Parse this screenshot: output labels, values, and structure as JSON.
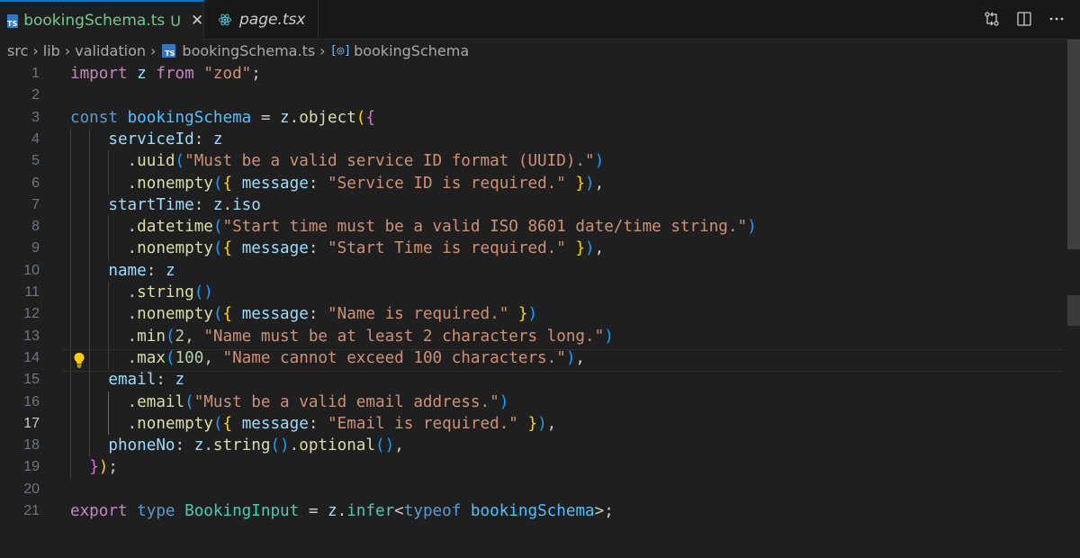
{
  "tabs": [
    {
      "label": "bookingSchema.ts",
      "badge": "U",
      "icon": "typescript-icon",
      "close": "✕",
      "active": true
    },
    {
      "label": "page.tsx",
      "icon": "react-icon",
      "active": false
    }
  ],
  "breadcrumb": {
    "items": [
      "src",
      "lib",
      "validation",
      "bookingSchema.ts",
      "bookingSchema"
    ],
    "separator": "›"
  },
  "ts_icon_text": "TS",
  "editor": {
    "current_line": 17,
    "lines": [
      {
        "n": "1",
        "tokens": [
          [
            "kw",
            "import"
          ],
          [
            "p",
            " "
          ],
          [
            "id",
            "z"
          ],
          [
            "p",
            " "
          ],
          [
            "kw",
            "from"
          ],
          [
            "p",
            " "
          ],
          [
            "str",
            "\"zod\""
          ],
          [
            "p",
            ";"
          ]
        ]
      },
      {
        "n": "2",
        "tokens": []
      },
      {
        "n": "3",
        "tokens": [
          [
            "kw2",
            "const"
          ],
          [
            "p",
            " "
          ],
          [
            "var",
            "bookingSchema"
          ],
          [
            "p",
            " = "
          ],
          [
            "id",
            "z"
          ],
          [
            "p",
            "."
          ],
          [
            "fn",
            "object"
          ],
          [
            "b1",
            "("
          ],
          [
            "b2",
            "{"
          ]
        ]
      },
      {
        "n": "4",
        "tokens": [
          [
            "p",
            "    "
          ],
          [
            "id",
            "serviceId"
          ],
          [
            "p",
            ": "
          ],
          [
            "id",
            "z"
          ]
        ]
      },
      {
        "n": "5",
        "tokens": [
          [
            "p",
            "      ."
          ],
          [
            "fn",
            "uuid"
          ],
          [
            "b3",
            "("
          ],
          [
            "str",
            "\"Must be a valid service ID format (UUID).\""
          ],
          [
            "b3",
            ")"
          ]
        ]
      },
      {
        "n": "6",
        "tokens": [
          [
            "p",
            "      ."
          ],
          [
            "fn",
            "nonempty"
          ],
          [
            "b3",
            "("
          ],
          [
            "b1",
            "{"
          ],
          [
            "p",
            " "
          ],
          [
            "id",
            "message"
          ],
          [
            "p",
            ": "
          ],
          [
            "str",
            "\"Service ID is required.\""
          ],
          [
            "p",
            " "
          ],
          [
            "b1",
            "}"
          ],
          [
            "b3",
            ")"
          ],
          [
            "p",
            ","
          ]
        ]
      },
      {
        "n": "7",
        "tokens": [
          [
            "p",
            "    "
          ],
          [
            "id",
            "startTime"
          ],
          [
            "p",
            ": "
          ],
          [
            "id",
            "z"
          ],
          [
            "p",
            "."
          ],
          [
            "id",
            "iso"
          ]
        ]
      },
      {
        "n": "8",
        "tokens": [
          [
            "p",
            "      ."
          ],
          [
            "fn",
            "datetime"
          ],
          [
            "b3",
            "("
          ],
          [
            "str",
            "\"Start time must be a valid ISO 8601 date/time string.\""
          ],
          [
            "b3",
            ")"
          ]
        ]
      },
      {
        "n": "9",
        "tokens": [
          [
            "p",
            "      ."
          ],
          [
            "fn",
            "nonempty"
          ],
          [
            "b3",
            "("
          ],
          [
            "b1",
            "{"
          ],
          [
            "p",
            " "
          ],
          [
            "id",
            "message"
          ],
          [
            "p",
            ": "
          ],
          [
            "str",
            "\"Start Time is required.\""
          ],
          [
            "p",
            " "
          ],
          [
            "b1",
            "}"
          ],
          [
            "b3",
            ")"
          ],
          [
            "p",
            ","
          ]
        ]
      },
      {
        "n": "10",
        "tokens": [
          [
            "p",
            "    "
          ],
          [
            "id",
            "name"
          ],
          [
            "p",
            ": "
          ],
          [
            "id",
            "z"
          ]
        ]
      },
      {
        "n": "11",
        "tokens": [
          [
            "p",
            "      ."
          ],
          [
            "fn",
            "string"
          ],
          [
            "b3",
            "()"
          ]
        ]
      },
      {
        "n": "12",
        "tokens": [
          [
            "p",
            "      ."
          ],
          [
            "fn",
            "nonempty"
          ],
          [
            "b3",
            "("
          ],
          [
            "b1",
            "{"
          ],
          [
            "p",
            " "
          ],
          [
            "id",
            "message"
          ],
          [
            "p",
            ": "
          ],
          [
            "str",
            "\"Name is required.\""
          ],
          [
            "p",
            " "
          ],
          [
            "b1",
            "}"
          ],
          [
            "b3",
            ")"
          ]
        ]
      },
      {
        "n": "13",
        "tokens": [
          [
            "p",
            "      ."
          ],
          [
            "fn",
            "min"
          ],
          [
            "b3",
            "("
          ],
          [
            "num",
            "2"
          ],
          [
            "p",
            ", "
          ],
          [
            "str",
            "\"Name must be at least 2 characters long.\""
          ],
          [
            "b3",
            ")"
          ]
        ]
      },
      {
        "n": "14",
        "tokens": [
          [
            "p",
            "      ."
          ],
          [
            "fn",
            "max"
          ],
          [
            "b3",
            "("
          ],
          [
            "num",
            "100"
          ],
          [
            "p",
            ", "
          ],
          [
            "str",
            "\"Name cannot exceed 100 characters.\""
          ],
          [
            "b3",
            ")"
          ],
          [
            "p",
            ","
          ]
        ]
      },
      {
        "n": "15",
        "tokens": [
          [
            "p",
            "    "
          ],
          [
            "id",
            "email"
          ],
          [
            "p",
            ": "
          ],
          [
            "id",
            "z"
          ]
        ]
      },
      {
        "n": "16",
        "tokens": [
          [
            "p",
            "      ."
          ],
          [
            "fn",
            "email"
          ],
          [
            "b3",
            "("
          ],
          [
            "str",
            "\"Must be a valid email address.\""
          ],
          [
            "b3",
            ")"
          ]
        ]
      },
      {
        "n": "17",
        "tokens": [
          [
            "p",
            "      ."
          ],
          [
            "fn",
            "nonempty"
          ],
          [
            "b3",
            "("
          ],
          [
            "b1",
            "{"
          ],
          [
            "p",
            " "
          ],
          [
            "id",
            "message"
          ],
          [
            "p",
            ": "
          ],
          [
            "str",
            "\"Email is required.\""
          ],
          [
            "p",
            " "
          ],
          [
            "b1",
            "}"
          ],
          [
            "b3",
            ")"
          ],
          [
            "p",
            ","
          ]
        ]
      },
      {
        "n": "18",
        "tokens": [
          [
            "p",
            "    "
          ],
          [
            "id",
            "phoneNo"
          ],
          [
            "p",
            ": "
          ],
          [
            "id",
            "z"
          ],
          [
            "p",
            "."
          ],
          [
            "fn",
            "string"
          ],
          [
            "b3",
            "()"
          ],
          [
            "p",
            "."
          ],
          [
            "fn",
            "optional"
          ],
          [
            "b3",
            "()"
          ],
          [
            "p",
            ","
          ]
        ]
      },
      {
        "n": "19",
        "tokens": [
          [
            "p",
            "  "
          ],
          [
            "b2",
            "}"
          ],
          [
            "b1",
            ")"
          ],
          [
            "p",
            ";"
          ]
        ]
      },
      {
        "n": "20",
        "tokens": []
      },
      {
        "n": "21",
        "tokens": [
          [
            "kw",
            "export"
          ],
          [
            "p",
            " "
          ],
          [
            "kw2",
            "type"
          ],
          [
            "p",
            " "
          ],
          [
            "type",
            "BookingInput"
          ],
          [
            "p",
            " = "
          ],
          [
            "id",
            "z"
          ],
          [
            "p",
            "."
          ],
          [
            "type",
            "infer"
          ],
          [
            "p",
            "<"
          ],
          [
            "kw2",
            "typeof"
          ],
          [
            "p",
            " "
          ],
          [
            "var",
            "bookingSchema"
          ],
          [
            "p",
            ">;"
          ]
        ]
      }
    ]
  }
}
